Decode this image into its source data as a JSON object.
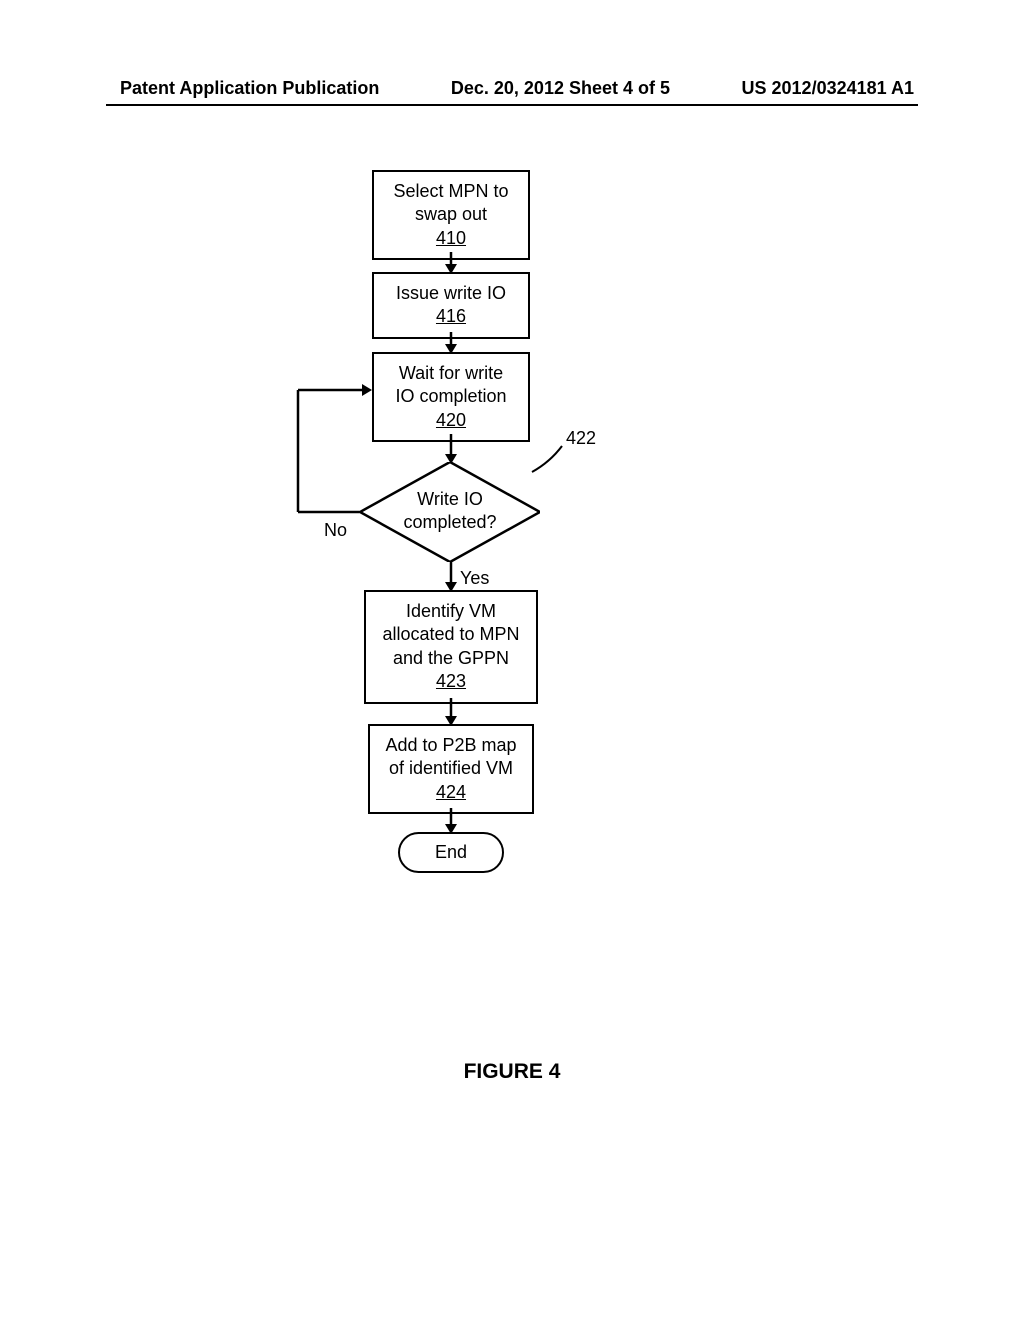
{
  "header": {
    "left": "Patent Application Publication",
    "center": "Dec. 20, 2012  Sheet 4 of 5",
    "right": "US 2012/0324181 A1"
  },
  "flow": {
    "box1": {
      "text": "Select MPN to\nswap out",
      "ref": "410"
    },
    "box2": {
      "text": "Issue write IO",
      "ref": "416"
    },
    "box3": {
      "text": "Wait for write\nIO completion",
      "ref": "420"
    },
    "decision": {
      "text": "Write IO\ncompleted?",
      "ref": "422",
      "no": "No",
      "yes": "Yes"
    },
    "box4": {
      "text": "Identify VM\nallocated to MPN\nand the GPPN",
      "ref": "423"
    },
    "box5": {
      "text": "Add to P2B map\nof identified VM",
      "ref": "424"
    },
    "end": "End"
  },
  "figure": "FIGURE 4"
}
